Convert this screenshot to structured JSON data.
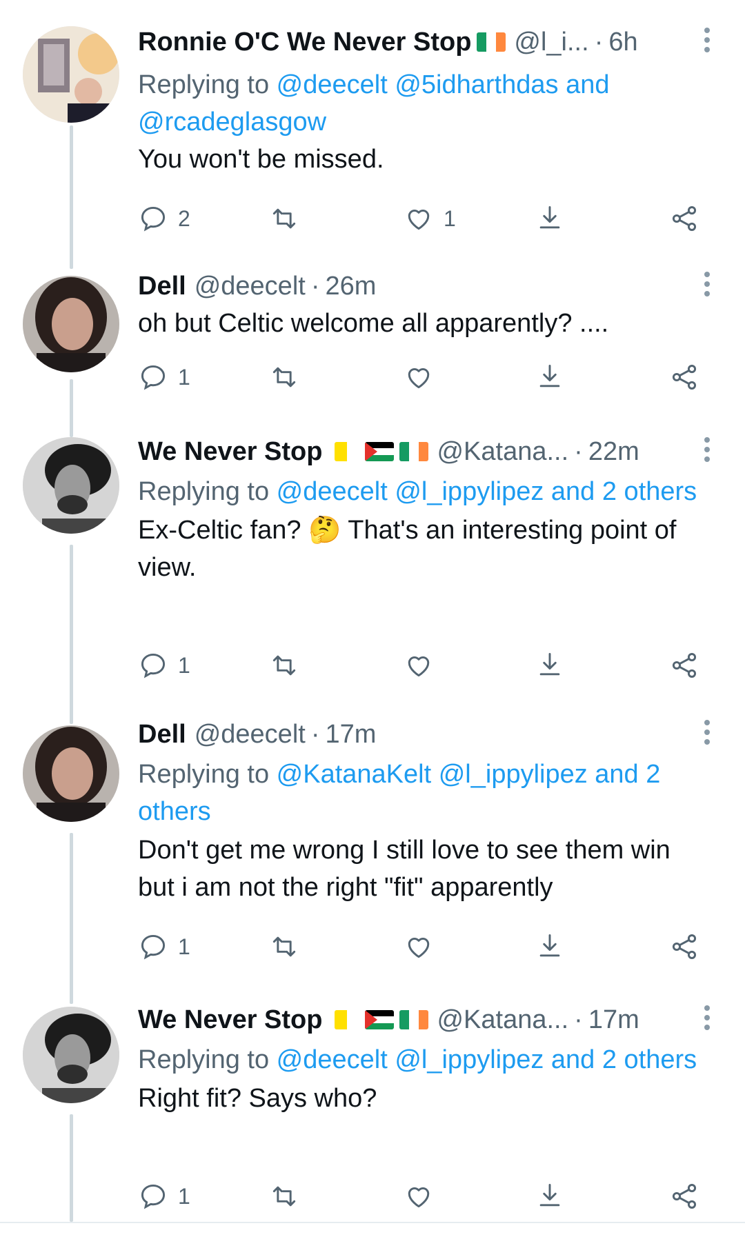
{
  "tweets": [
    {
      "display_name": "Ronnie O'C We Never Stop",
      "handle": "@l_i...",
      "time": "6h",
      "reply_prefix": "Replying to ",
      "reply_mentions": "@deecelt @5idharthdas and @rcadeglasgow",
      "text": "You won't be missed.",
      "reply_count": "2",
      "retweet_count": "",
      "like_count": "1"
    },
    {
      "display_name": "Dell",
      "handle": "@deecelt",
      "time": "26m",
      "text": "oh but Celtic welcome all apparently? ....",
      "reply_count": "1",
      "retweet_count": "",
      "like_count": ""
    },
    {
      "display_name": "We Never Stop",
      "handle": "@Katana...",
      "time": "22m",
      "reply_prefix": "Replying to ",
      "reply_mentions": "@deecelt @l_ippylipez and 2 others",
      "text": "Ex-Celtic fan? 🤔 That's an interesting point of view.",
      "reply_count": "1",
      "retweet_count": "",
      "like_count": ""
    },
    {
      "display_name": "Dell",
      "handle": "@deecelt",
      "time": "17m",
      "reply_prefix": "Replying to ",
      "reply_mentions": "@KatanaKelt @l_ippylipez and 2 others",
      "text": "Don't get me wrong I still love to see them win but i am not the right \"fit\" apparently",
      "reply_count": "1",
      "retweet_count": "",
      "like_count": ""
    },
    {
      "display_name": "We Never Stop",
      "handle": "@Katana...",
      "time": "17m",
      "reply_prefix": "Replying to ",
      "reply_mentions": "@deecelt @l_ippylipez and 2 others",
      "text": "Right fit? Says who?",
      "reply_count": "1",
      "retweet_count": "",
      "like_count": ""
    }
  ],
  "separator": "·",
  "icons": {
    "reply": "reply-icon",
    "retweet": "retweet-icon",
    "like": "heart-icon",
    "download": "download-icon",
    "share": "share-icon",
    "more": "more-icon"
  },
  "colors": {
    "mention": "#1d9bf0",
    "secondary_text": "#536471",
    "primary_text": "#0f1419",
    "thread_line": "#cfd9de"
  }
}
